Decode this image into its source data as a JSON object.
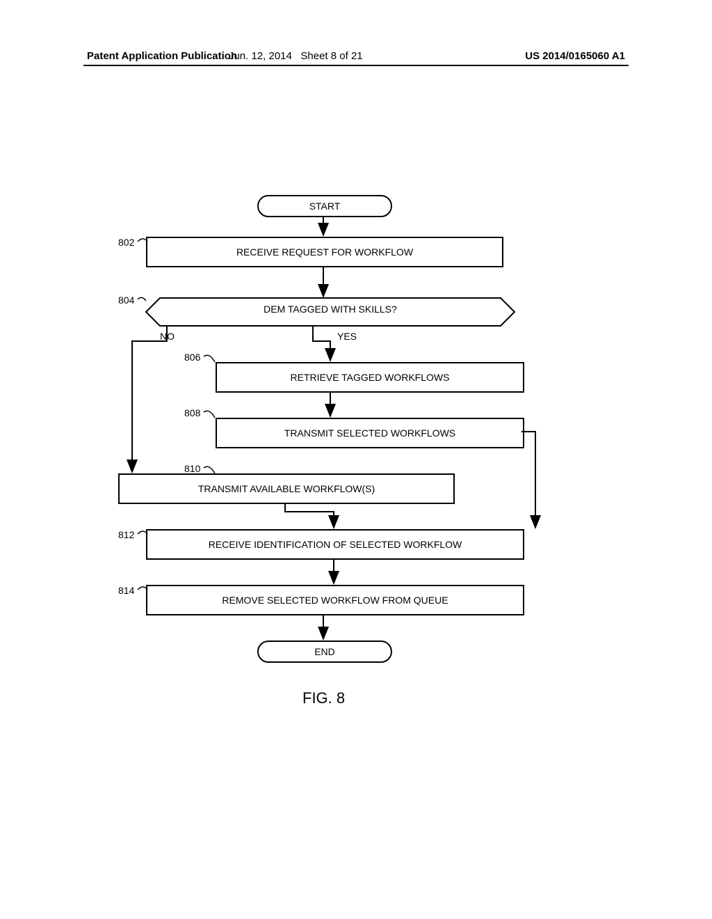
{
  "header": {
    "left": "Patent Application Publication",
    "date": "Jun. 12, 2014",
    "sheet": "Sheet 8 of 21",
    "pubno": "US 2014/0165060 A1"
  },
  "figure": {
    "caption": "FIG. 8",
    "start": "START",
    "end": "END",
    "steps": {
      "s802": {
        "ref": "802",
        "text": "RECEIVE REQUEST FOR WORKFLOW"
      },
      "s804": {
        "ref": "804",
        "text": "DEM TAGGED WITH SKILLS?"
      },
      "s806": {
        "ref": "806",
        "text": "RETRIEVE TAGGED WORKFLOWS"
      },
      "s808": {
        "ref": "808",
        "text": "TRANSMIT SELECTED WORKFLOWS"
      },
      "s810": {
        "ref": "810",
        "text": "TRANSMIT AVAILABLE WORKFLOW(S)"
      },
      "s812": {
        "ref": "812",
        "text": "RECEIVE IDENTIFICATION OF SELECTED WORKFLOW"
      },
      "s814": {
        "ref": "814",
        "text": "REMOVE SELECTED WORKFLOW FROM QUEUE"
      }
    },
    "branches": {
      "yes": "YES",
      "no": "NO"
    }
  }
}
